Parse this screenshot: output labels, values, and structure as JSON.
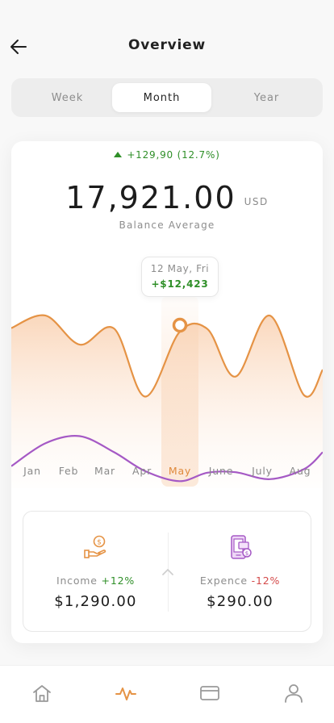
{
  "header": {
    "title": "Overview",
    "back_icon": "arrow-left-icon"
  },
  "period_tabs": [
    {
      "label": "Week",
      "active": false
    },
    {
      "label": "Month",
      "active": true
    },
    {
      "label": "Year",
      "active": false
    }
  ],
  "summary_header": {
    "delta_text": "+129,90 (12.7%)",
    "balance_value": "17,921.00",
    "balance_unit": "USD",
    "balance_label": "Balance Average"
  },
  "tooltip": {
    "date": "12 May, Fri",
    "value": "+$12,423"
  },
  "chart_data": {
    "type": "line",
    "categories": [
      "Jan",
      "Feb",
      "Mar",
      "Apr",
      "May",
      "June",
      "July",
      "Aug"
    ],
    "selected_category": "May",
    "series": [
      {
        "values": [
          320,
          345,
          287,
          319,
          183,
          312,
          318,
          223,
          345,
          186,
          237
        ],
        "color": "#e59345"
      },
      {
        "values": [
          44,
          90,
          104,
          72,
          34,
          14,
          31,
          32,
          18,
          38,
          72
        ],
        "color": "#a559c5"
      }
    ],
    "x_positions_frac": [
      0,
      0.11,
      0.22,
      0.33,
      0.43,
      0.54,
      0.63,
      0.72,
      0.83,
      0.94,
      1
    ]
  },
  "income": {
    "label": "Income",
    "change": "+12%",
    "amount": "$1,290.00",
    "icon": "money-hand-icon"
  },
  "expense": {
    "label": "Expence",
    "change": "-12%",
    "amount": "$290.00",
    "icon": "phone-payment-icon"
  },
  "colors": {
    "accent": "#e59345",
    "income_green": "#2f8f28",
    "expense_red": "#d44a4a",
    "secondary_line": "#a559c5"
  },
  "tabbar": [
    {
      "icon": "home-icon",
      "active": false
    },
    {
      "icon": "activity-icon",
      "active": true
    },
    {
      "icon": "card-icon",
      "active": false
    },
    {
      "icon": "profile-icon",
      "active": false
    }
  ]
}
